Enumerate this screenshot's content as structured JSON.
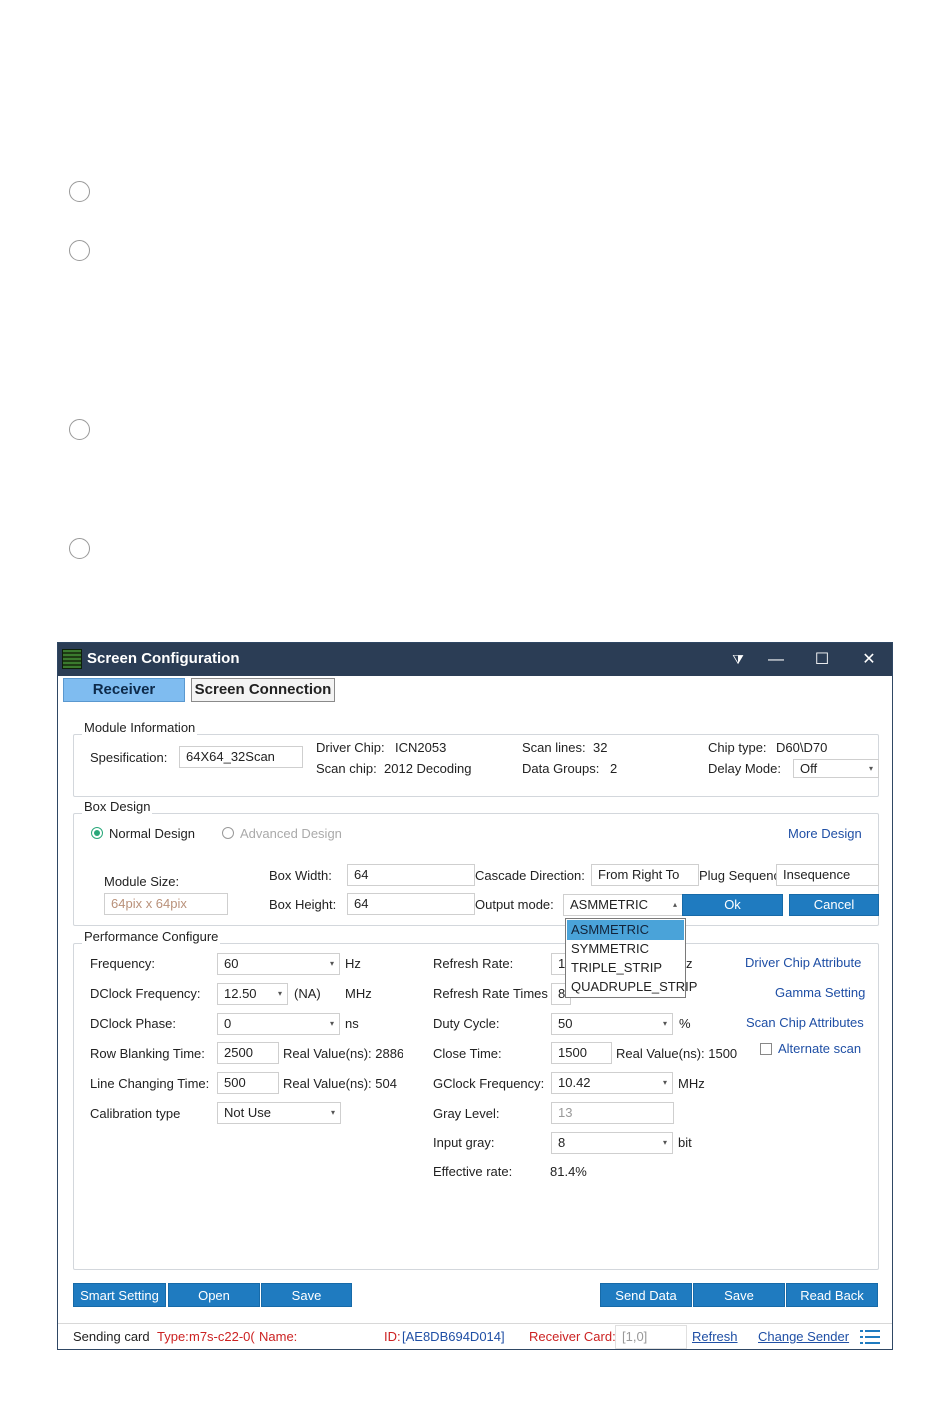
{
  "window": {
    "title": "Screen Configuration",
    "controls": {
      "menu": "⧩",
      "minimize": "—",
      "maximize": "☐",
      "close": "✕"
    }
  },
  "tabs": [
    {
      "label": "Receiver",
      "active": true
    },
    {
      "label": "Screen Connection",
      "active": false
    }
  ],
  "module_info": {
    "group_label": "Module Information",
    "spec_label": "Spesification:",
    "spec_value": "64X64_32Scan",
    "driver_chip_label": "Driver Chip:",
    "driver_chip_value": "ICN2053",
    "scan_chip_label": "Scan chip:",
    "scan_chip_value": "2012 Decoding",
    "scan_lines_label": "Scan lines:",
    "scan_lines_value": "32",
    "data_groups_label": "Data Groups:",
    "data_groups_value": "2",
    "chip_type_label": "Chip type:",
    "chip_type_value": "D60\\D70",
    "delay_mode_label": "Delay Mode:",
    "delay_mode_value": "Off"
  },
  "box_design": {
    "group_label": "Box Design",
    "normal_design": "Normal Design",
    "advanced_design": "Advanced Design",
    "more_design": "More Design",
    "module_size_label": "Module Size:",
    "module_size_value": "64pix x 64pix",
    "box_width_label": "Box Width:",
    "box_width_value": "64",
    "box_height_label": "Box Height:",
    "box_height_value": "64",
    "cascade_label": "Cascade Direction:",
    "cascade_value": "From Right To",
    "plug_label": "Plug Sequence:",
    "plug_value": "Insequence",
    "output_mode_label": "Output mode:",
    "output_mode_value": "ASMMETRIC",
    "ok": "Ok",
    "cancel": "Cancel",
    "output_options": [
      "ASMMETRIC",
      "SYMMETRIC",
      "TRIPLE_STRIP",
      "QUADRUPLE_STRIP"
    ]
  },
  "performance": {
    "group_label": "Performance Configure",
    "frequency_label": "Frequency:",
    "frequency_value": "60",
    "frequency_unit": "Hz",
    "dclock_freq_label": "DClock Frequency:",
    "dclock_freq_value": "12.50",
    "dclock_na": "(NA)",
    "dclock_unit": "MHz",
    "dclock_phase_label": "DClock Phase:",
    "dclock_phase_value": "0",
    "dclock_phase_unit": "ns",
    "row_blank_label": "Row Blanking Time:",
    "row_blank_value": "2500",
    "row_blank_real": "Real Value(ns): 2886",
    "line_change_label": "Line Changing Time:",
    "line_change_value": "500",
    "line_change_real": "Real Value(ns): 504",
    "calib_label": "Calibration type",
    "calib_value": "Not Use",
    "refresh_rate_label": "Refresh Rate:",
    "refresh_rate_value": "1",
    "refresh_rate_unit": "z",
    "refresh_times_label": "Refresh Rate Times",
    "refresh_times_value": "8",
    "duty_label": "Duty Cycle:",
    "duty_value": "50",
    "duty_unit": "%",
    "close_time_label": "Close Time:",
    "close_time_value": "1500",
    "close_time_real": "Real Value(ns): 1500",
    "gclock_label": "GClock Frequency:",
    "gclock_value": "10.42",
    "gclock_unit": "MHz",
    "gray_level_label": "Gray Level:",
    "gray_level_value": "13",
    "input_gray_label": "Input gray:",
    "input_gray_value": "8",
    "input_gray_unit": "bit",
    "effective_label": "Effective rate:",
    "effective_value": "81.4%",
    "driver_chip_attr": "Driver Chip Attribute",
    "gamma_setting": "Gamma Setting",
    "scan_chip_attr": "Scan Chip Attributes",
    "alternate_scan": "Alternate scan"
  },
  "buttons": {
    "smart_setting": "Smart Setting",
    "open": "Open",
    "save_left": "Save",
    "send_data": "Send Data",
    "save_right": "Save",
    "read_back": "Read Back"
  },
  "status": {
    "sending_card": "Sending card",
    "type_label": "Type:",
    "type_value": "m7s-c22-0(",
    "name_label": "Name:",
    "id_label": "ID:",
    "id_value": "[AE8DB694D014]",
    "receiver_card_label": "Receiver Card:",
    "receiver_card_value": "[1,0]",
    "refresh": "Refresh",
    "change_sender": "Change Sender"
  },
  "colors": {
    "titlebar": "#2b3d55",
    "tab_active": "#7fbcf0",
    "button_blue": "#1f7bc0",
    "link_blue": "#1f4fa5",
    "dropdown_selected": "#4aa3d9",
    "radio_green": "#2aa87a"
  }
}
